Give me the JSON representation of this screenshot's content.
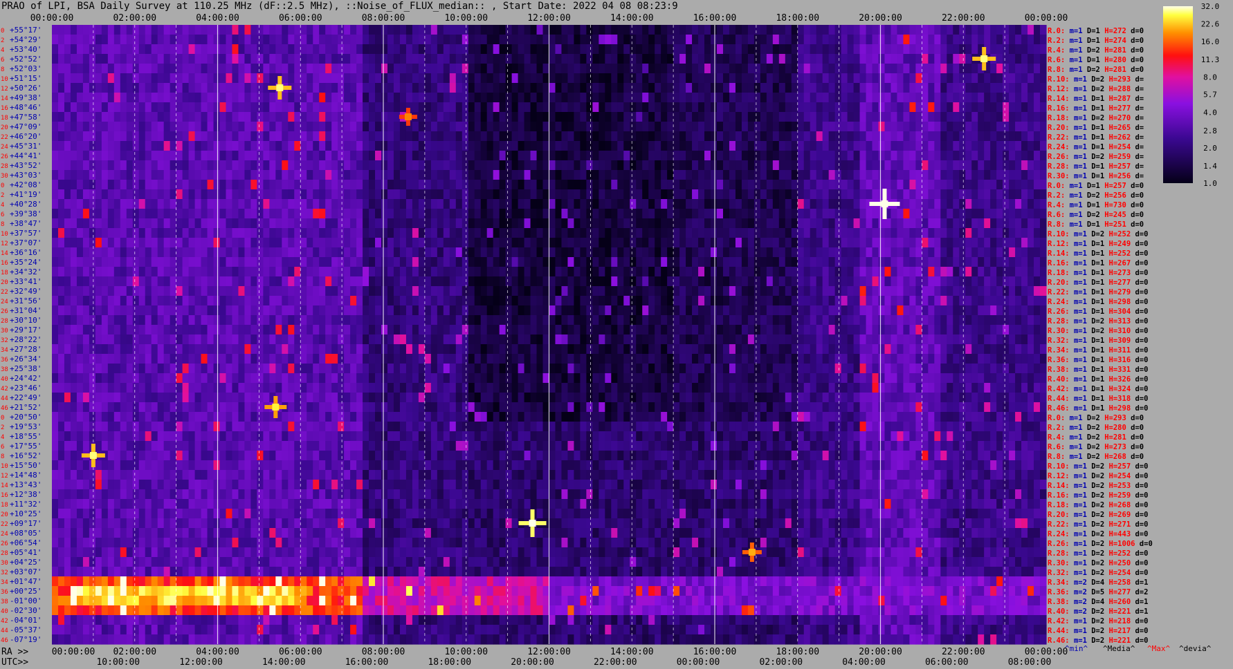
{
  "title": "PRAO of LPI, BSA Daily Survey at 110.25 MHz (dF::2.5 MHz), ::Noise_of_FLUX_median:: , Start Date: 2022 04 08 08:23:9",
  "chart_data": {
    "type": "heatmap",
    "top_axis_ticks": [
      "00:00:00",
      "02:00:00",
      "04:00:00",
      "06:00:00",
      "08:00:00",
      "10:00:00",
      "12:00:00",
      "14:00:00",
      "16:00:00",
      "18:00:00",
      "20:00:00",
      "22:00:00",
      "00:00:00"
    ],
    "ra_axis_label": "RA >>",
    "ra_axis_ticks": [
      "00:00:00",
      "02:00:00",
      "04:00:00",
      "06:00:00",
      "08:00:00",
      "10:00:00",
      "12:00:00",
      "14:00:00",
      "16:00:00",
      "18:00:00",
      "20:00:00",
      "22:00:00",
      "00:00:00"
    ],
    "utc_axis_label": "UTC>>",
    "utc_axis_ticks": [
      "10:00:00",
      "12:00:00",
      "14:00:00",
      "16:00:00",
      "18:00:00",
      "20:00:00",
      "22:00:00",
      "00:00:00",
      "02:00:00",
      "04:00:00",
      "06:00:00",
      "08:00:00"
    ],
    "dec_labels": [
      "+55°17'",
      "+54°29'",
      "+53°40'",
      "+52°52'",
      "+52°03'",
      "+51°15'",
      "+50°26'",
      "+49°38'",
      "+48°46'",
      "+47°58'",
      "+47°09'",
      "+46°20'",
      "+45°31'",
      "+44°41'",
      "+43°52'",
      "+43°03'",
      "+42°08'",
      "+41°19'",
      "+40°28'",
      "+39°38'",
      "+38°47'",
      "+37°57'",
      "+37°07'",
      "+36°16'",
      "+35°24'",
      "+34°32'",
      "+33°41'",
      "+32°49'",
      "+31°56'",
      "+31°04'",
      "+30°10'",
      "+29°17'",
      "+28°22'",
      "+27°28'",
      "+26°34'",
      "+25°38'",
      "+24°42'",
      "+23°46'",
      "+22°49'",
      "+21°52'",
      "+20°50'",
      "+19°53'",
      "+18°55'",
      "+17°55'",
      "+16°52'",
      "+15°50'",
      "+14°48'",
      "+13°43'",
      "+12°38'",
      "+11°32'",
      "+10°25'",
      "+09°17'",
      "+08°05'",
      "+06°54'",
      "+05°41'",
      "+04°25'",
      "+03°07'",
      "+01°47'",
      "+00°25'",
      "-01°00'",
      "-02°30'",
      "-04°01'",
      "-05°37'",
      "-07°19'"
    ],
    "row_index_labels": [
      "0",
      "2",
      "4",
      "6",
      "8",
      "10",
      "12",
      "14",
      "16",
      "18",
      "20",
      "22",
      "24",
      "26",
      "28",
      "30",
      "0",
      "2",
      "4",
      "6",
      "8",
      "10",
      "12",
      "14",
      "16",
      "18",
      "20",
      "22",
      "24",
      "26",
      "28",
      "30",
      "32",
      "34",
      "36",
      "38",
      "40",
      "42",
      "44",
      "46",
      "0",
      "2",
      "4",
      "6",
      "8",
      "10",
      "12",
      "14",
      "16",
      "18",
      "20",
      "22",
      "24",
      "26",
      "28",
      "30",
      "32",
      "34",
      "36",
      "38",
      "40",
      "42",
      "44",
      "46"
    ],
    "stats": [
      {
        "r": "R.0:",
        "m": "1",
        "d": "1",
        "h": "272",
        "dev": "0"
      },
      {
        "r": "R.2:",
        "m": "1",
        "d": "1",
        "h": "274",
        "dev": "0"
      },
      {
        "r": "R.4:",
        "m": "1",
        "d": "2",
        "h": "281",
        "dev": "0"
      },
      {
        "r": "R.6:",
        "m": "1",
        "d": "1",
        "h": "280",
        "dev": "0"
      },
      {
        "r": "R.8:",
        "m": "1",
        "d": "2",
        "h": "281",
        "dev": "0"
      },
      {
        "r": "R.10:",
        "m": "1",
        "d": "2",
        "h": "293",
        "dev": ""
      },
      {
        "r": "R.12:",
        "m": "1",
        "d": "2",
        "h": "288",
        "dev": ""
      },
      {
        "r": "R.14:",
        "m": "1",
        "d": "1",
        "h": "287",
        "dev": ""
      },
      {
        "r": "R.16:",
        "m": "1",
        "d": "1",
        "h": "277",
        "dev": ""
      },
      {
        "r": "R.18:",
        "m": "1",
        "d": "2",
        "h": "270",
        "dev": ""
      },
      {
        "r": "R.20:",
        "m": "1",
        "d": "1",
        "h": "265",
        "dev": ""
      },
      {
        "r": "R.22:",
        "m": "1",
        "d": "1",
        "h": "262",
        "dev": ""
      },
      {
        "r": "R.24:",
        "m": "1",
        "d": "1",
        "h": "254",
        "dev": ""
      },
      {
        "r": "R.26:",
        "m": "1",
        "d": "2",
        "h": "259",
        "dev": ""
      },
      {
        "r": "R.28:",
        "m": "1",
        "d": "1",
        "h": "257",
        "dev": ""
      },
      {
        "r": "R.30:",
        "m": "1",
        "d": "1",
        "h": "256",
        "dev": ""
      },
      {
        "r": "R.0:",
        "m": "1",
        "d": "1",
        "h": "257",
        "dev": "0"
      },
      {
        "r": "R.2:",
        "m": "1",
        "d": "2",
        "h": "256",
        "dev": "0"
      },
      {
        "r": "R.4:",
        "m": "1",
        "d": "1",
        "h": "730",
        "dev": "0"
      },
      {
        "r": "R.6:",
        "m": "1",
        "d": "2",
        "h": "245",
        "dev": "0"
      },
      {
        "r": "R.8:",
        "m": "1",
        "d": "1",
        "h": "251",
        "dev": "0"
      },
      {
        "r": "R.10:",
        "m": "1",
        "d": "2",
        "h": "252",
        "dev": "0"
      },
      {
        "r": "R.12:",
        "m": "1",
        "d": "1",
        "h": "249",
        "dev": "0"
      },
      {
        "r": "R.14:",
        "m": "1",
        "d": "1",
        "h": "252",
        "dev": "0"
      },
      {
        "r": "R.16:",
        "m": "1",
        "d": "1",
        "h": "267",
        "dev": "0"
      },
      {
        "r": "R.18:",
        "m": "1",
        "d": "1",
        "h": "273",
        "dev": "0"
      },
      {
        "r": "R.20:",
        "m": "1",
        "d": "1",
        "h": "277",
        "dev": "0"
      },
      {
        "r": "R.22:",
        "m": "1",
        "d": "1",
        "h": "279",
        "dev": "0"
      },
      {
        "r": "R.24:",
        "m": "1",
        "d": "1",
        "h": "298",
        "dev": "0"
      },
      {
        "r": "R.26:",
        "m": "1",
        "d": "1",
        "h": "304",
        "dev": "0"
      },
      {
        "r": "R.28:",
        "m": "1",
        "d": "2",
        "h": "313",
        "dev": "0"
      },
      {
        "r": "R.30:",
        "m": "1",
        "d": "2",
        "h": "310",
        "dev": "0"
      },
      {
        "r": "R.32:",
        "m": "1",
        "d": "1",
        "h": "309",
        "dev": "0"
      },
      {
        "r": "R.34:",
        "m": "1",
        "d": "1",
        "h": "311",
        "dev": "0"
      },
      {
        "r": "R.36:",
        "m": "1",
        "d": "1",
        "h": "316",
        "dev": "0"
      },
      {
        "r": "R.38:",
        "m": "1",
        "d": "1",
        "h": "331",
        "dev": "0"
      },
      {
        "r": "R.40:",
        "m": "1",
        "d": "1",
        "h": "326",
        "dev": "0"
      },
      {
        "r": "R.42:",
        "m": "1",
        "d": "1",
        "h": "324",
        "dev": "0"
      },
      {
        "r": "R.44:",
        "m": "1",
        "d": "1",
        "h": "318",
        "dev": "0"
      },
      {
        "r": "R.46:",
        "m": "1",
        "d": "1",
        "h": "298",
        "dev": "0"
      },
      {
        "r": "R.0:",
        "m": "1",
        "d": "2",
        "h": "293",
        "dev": "0"
      },
      {
        "r": "R.2:",
        "m": "1",
        "d": "2",
        "h": "280",
        "dev": "0"
      },
      {
        "r": "R.4:",
        "m": "1",
        "d": "2",
        "h": "281",
        "dev": "0"
      },
      {
        "r": "R.6:",
        "m": "1",
        "d": "2",
        "h": "273",
        "dev": "0"
      },
      {
        "r": "R.8:",
        "m": "1",
        "d": "2",
        "h": "268",
        "dev": "0"
      },
      {
        "r": "R.10:",
        "m": "1",
        "d": "2",
        "h": "257",
        "dev": "0"
      },
      {
        "r": "R.12:",
        "m": "1",
        "d": "2",
        "h": "254",
        "dev": "0"
      },
      {
        "r": "R.14:",
        "m": "1",
        "d": "2",
        "h": "253",
        "dev": "0"
      },
      {
        "r": "R.16:",
        "m": "1",
        "d": "2",
        "h": "259",
        "dev": "0"
      },
      {
        "r": "R.18:",
        "m": "1",
        "d": "2",
        "h": "268",
        "dev": "0"
      },
      {
        "r": "R.20:",
        "m": "1",
        "d": "2",
        "h": "269",
        "dev": "0"
      },
      {
        "r": "R.22:",
        "m": "1",
        "d": "2",
        "h": "271",
        "dev": "0"
      },
      {
        "r": "R.24:",
        "m": "1",
        "d": "2",
        "h": "443",
        "dev": "0"
      },
      {
        "r": "R.26:",
        "m": "1",
        "d": "2",
        "h": "1006",
        "dev": "0"
      },
      {
        "r": "R.28:",
        "m": "1",
        "d": "2",
        "h": "252",
        "dev": "0"
      },
      {
        "r": "R.30:",
        "m": "1",
        "d": "2",
        "h": "250",
        "dev": "0"
      },
      {
        "r": "R.32:",
        "m": "1",
        "d": "2",
        "h": "254",
        "dev": "0"
      },
      {
        "r": "R.34:",
        "m": "2",
        "d": "4",
        "h": "258",
        "dev": "1"
      },
      {
        "r": "R.36:",
        "m": "2",
        "d": "5",
        "h": "277",
        "dev": "2"
      },
      {
        "r": "R.38:",
        "m": "2",
        "d": "4",
        "h": "260",
        "dev": "1"
      },
      {
        "r": "R.40:",
        "m": "2",
        "d": "2",
        "h": "221",
        "dev": "1"
      },
      {
        "r": "R.42:",
        "m": "1",
        "d": "2",
        "h": "218",
        "dev": "0"
      },
      {
        "r": "R.44:",
        "m": "1",
        "d": "2",
        "h": "217",
        "dev": "0"
      },
      {
        "r": "R.46:",
        "m": "1",
        "d": "2",
        "h": "221",
        "dev": "0"
      }
    ],
    "stat_prefix": {
      "m": "m=",
      "d": "D=",
      "h": "H=",
      "dev": "d="
    },
    "legend_footer": {
      "min": "^min^",
      "median": "^Media^",
      "max": "^Max^",
      "dev": "^devia^"
    },
    "colorbar_ticks": [
      "32.0",
      "22.6",
      "16.0",
      "11.3",
      "8.0",
      "5.7",
      "4.0",
      "2.8",
      "2.0",
      "1.4",
      "1.0"
    ],
    "colorbar_range": [
      1.0,
      32.0
    ],
    "colorbar_scale": "log",
    "colors": {
      "background": "#ababab",
      "heat_low": "#050018",
      "heat_mid": "#7a10e0",
      "heat_high": "#ff1010",
      "heat_top": "#ffffe0",
      "stat_red": "#ff0000",
      "stat_blue": "#0000b0"
    },
    "hot_sources": [
      {
        "ra_h": 20.1,
        "dec_row": 18,
        "level": 32
      },
      {
        "ra_h": 11.6,
        "dec_row": 51,
        "level": 28
      },
      {
        "ra_h": 5.5,
        "dec_row": 6,
        "level": 22
      },
      {
        "ra_h": 22.5,
        "dec_row": 3,
        "level": 22
      },
      {
        "ra_h": 5.4,
        "dec_row": 39,
        "level": 20
      },
      {
        "ra_h": 16.9,
        "dec_row": 54,
        "level": 16
      },
      {
        "ra_h": 1.0,
        "dec_row": 44,
        "level": 22
      },
      {
        "ra_h": 8.6,
        "dec_row": 9,
        "level": 14
      }
    ]
  }
}
